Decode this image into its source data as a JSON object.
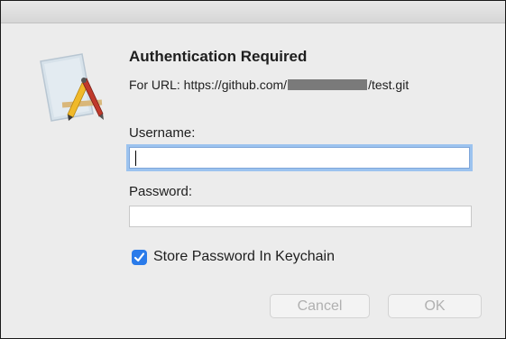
{
  "dialog": {
    "title": "Authentication Required",
    "url_prefix": "For URL: https://github.com/",
    "url_suffix": "/test.git"
  },
  "form": {
    "username_label": "Username:",
    "username_value": "",
    "password_label": "Password:",
    "password_value": "",
    "store_password_label": "Store Password In Keychain",
    "store_password_checked": true
  },
  "buttons": {
    "cancel_label": "Cancel",
    "ok_label": "OK"
  },
  "icons": {
    "app": "script-editor-app-icon",
    "checkbox": "checkmark-icon"
  },
  "colors": {
    "checkbox": "#2a7bea",
    "focus_ring": "#9cc3ef"
  }
}
